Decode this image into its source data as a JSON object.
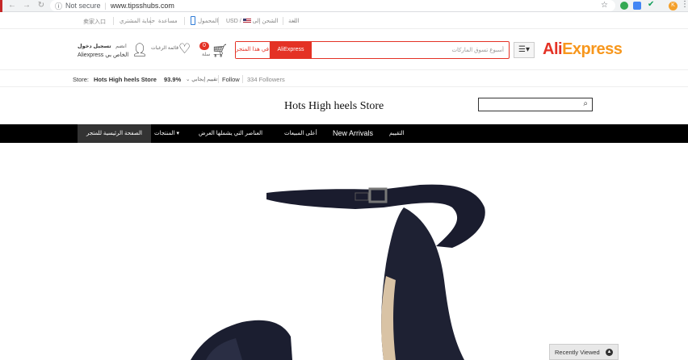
{
  "browser": {
    "security": "Not secure",
    "url": "www.tipsshubs.com",
    "avatar_letter": "K"
  },
  "topbar": {
    "lang": "اللغة",
    "ship_to": "الشحن إلى",
    "currency": "USD",
    "mobile": "المحمول",
    "help": "مساعدة",
    "buyer_protection": "حماية المشتري",
    "cn_link": "卖家入口"
  },
  "header": {
    "logo_a": "Ali",
    "logo_b": "Express",
    "search_placeholder": "أسبوع تسوق الماركات",
    "btn_aliexpress": "AliExpress",
    "btn_store": "في هذا المتجر",
    "cart_count": "0",
    "cart_label": "سلة",
    "wishlist_label": "قائمة الرغبات",
    "signin_top_a": "انضم",
    "signin_top_b": "تسجيل دخول",
    "signin_bottom": "Aliexpress الخاص بي"
  },
  "storerow": {
    "store_label": "Store:",
    "store_name": "Hots High heels Store",
    "rating": "93.9%",
    "rating_label": "تقييم إيجابي",
    "follow": "Follow",
    "followers": "334 Followers"
  },
  "banner": {
    "title": "Hots High heels Store"
  },
  "nav": {
    "home": "الصفحة الرئيسية للمتجر",
    "products": "المنتجات",
    "sale_items": "العناصر التي يشملها العرض",
    "top_selling": "أعلى المبيعات",
    "new_arrivals": "New Arrivals",
    "feedback": "التقييم"
  },
  "recently_viewed": "Recently Viewed"
}
